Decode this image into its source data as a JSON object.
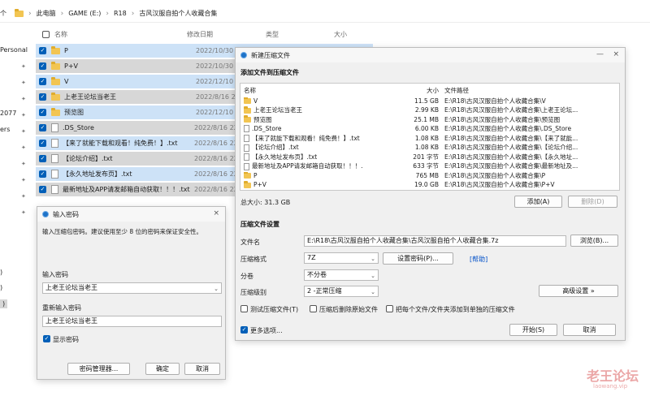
{
  "explorer": {
    "up_arrow": "个",
    "breadcrumbs": [
      "此电脑",
      "GAME (E:)",
      "R18",
      "古风汉服自拍个人收藏合集"
    ],
    "sidebar": [
      {
        "label": "Personal"
      },
      {
        "label": "2077"
      },
      {
        "label": "ers"
      },
      {
        "label": ")"
      },
      {
        "label": ")"
      },
      {
        "label": ")"
      }
    ],
    "columns": {
      "name": "名称",
      "date": "修改日期",
      "type": "类型",
      "size": "大小"
    },
    "rows": [
      {
        "name": "P",
        "date": "2022/10/30 20:5",
        "kind": "folder"
      },
      {
        "name": "P+V",
        "date": "2022/10/30 19:5",
        "kind": "folder"
      },
      {
        "name": "V",
        "date": "2022/12/10 18:4",
        "kind": "folder"
      },
      {
        "name": "上老王论坛当老王",
        "date": "2022/8/16 22:00",
        "kind": "folder"
      },
      {
        "name": "预览图",
        "date": "2022/12/10 20:5",
        "kind": "folder"
      },
      {
        "name": ".DS_Store",
        "date": "2022/8/16 22:00",
        "kind": "file"
      },
      {
        "name": "【来了就能下载和观看！纯免费！】.txt",
        "date": "2022/8/16 22:00",
        "kind": "file"
      },
      {
        "name": "【论坛介绍】.txt",
        "date": "2022/8/16 22:00",
        "kind": "file"
      },
      {
        "name": "【永久地址发布页】.txt",
        "date": "2022/8/16 22:00",
        "kind": "file"
      },
      {
        "name": "最新地址及APP请发邮箱自动获取！！！.txt",
        "date": "2022/8/16 22:00",
        "kind": "file"
      }
    ]
  },
  "password_dialog": {
    "title": "输入密码",
    "close": "×",
    "instruction": "输入压缩包密码。建议使用至少 8 位的密码来保证安全性。",
    "password_label": "输入密码",
    "password_value": "上老王论坛当老王",
    "reenter_label": "重新输入密码",
    "reenter_value": "上老王论坛当老王",
    "show_password_label": "显示密码",
    "buttons": {
      "manager": "密码管理器...",
      "ok": "确定",
      "cancel": "取消"
    }
  },
  "archive_dialog": {
    "title": "新建压缩文件",
    "min": "—",
    "close": "×",
    "add_section": "添加文件到压缩文件",
    "list_headers": {
      "name": "名称",
      "size": "大小",
      "path": "文件路径"
    },
    "items": [
      {
        "name": "V",
        "size": "11.5 GB",
        "path": "E:\\R18\\古风汉服自拍个人收藏合集\\V",
        "kind": "folder"
      },
      {
        "name": "上老王论坛当老王",
        "size": "2.99 KB",
        "path": "E:\\R18\\古风汉服自拍个人收藏合集\\上老王论坛...",
        "kind": "folder"
      },
      {
        "name": "预览图",
        "size": "25.1 MB",
        "path": "E:\\R18\\古风汉服自拍个人收藏合集\\预览图",
        "kind": "folder"
      },
      {
        "name": ".DS_Store",
        "size": "6.00 KB",
        "path": "E:\\R18\\古风汉服自拍个人收藏合集\\.DS_Store",
        "kind": "file"
      },
      {
        "name": "【来了就能下载和观看！纯免费！】.txt",
        "size": "1.08 KB",
        "path": "E:\\R18\\古风汉服自拍个人收藏合集\\【来了就能...",
        "kind": "file"
      },
      {
        "name": "【论坛介绍】.txt",
        "size": "1.08 KB",
        "path": "E:\\R18\\古风汉服自拍个人收藏合集\\【论坛介绍...",
        "kind": "file"
      },
      {
        "name": "【永久地址发布页】.txt",
        "size": "201 字节",
        "path": "E:\\R18\\古风汉服自拍个人收藏合集\\【永久地址...",
        "kind": "file"
      },
      {
        "name": "最新地址及APP请发邮箱自动获取！！！.txt",
        "size": "633 字节",
        "path": "E:\\R18\\古风汉服自拍个人收藏合集\\最新地址及...",
        "kind": "file"
      },
      {
        "name": "P",
        "size": "765 MB",
        "path": "E:\\R18\\古风汉服自拍个人收藏合集\\P",
        "kind": "folder"
      },
      {
        "name": "P+V",
        "size": "19.0 GB",
        "path": "E:\\R18\\古风汉服自拍个人收藏合集\\P+V",
        "kind": "folder"
      }
    ],
    "total": "总大小: 31.3 GB",
    "add_button": "添加(A)",
    "delete_button": "删除(D)",
    "settings_section": "压缩文件设置",
    "filename_label": "文件名",
    "filename_value": "E:\\R18\\古风汉服自拍个人收藏合集\\古风汉服自拍个人收藏合集.7z",
    "browse_button": "浏览(B)...",
    "format_label": "压缩格式",
    "format_value": "7Z",
    "set_password_button": "设置密码(P)...",
    "help_link": "[帮助]",
    "split_label": "分卷",
    "split_value": "不分卷",
    "level_label": "压缩级别",
    "level_value": "2 -正常压缩",
    "advanced_button": "高级设置 »",
    "options": [
      "测试压缩文件(T)",
      "压缩后删除原始文件",
      "把每个文件/文件夹添加到单独的压缩文件"
    ],
    "more_options": "更多选项...",
    "start_button": "开始(S)",
    "cancel_button": "取消"
  },
  "watermark": {
    "title": "老王论坛",
    "url": "laowang.vip"
  }
}
